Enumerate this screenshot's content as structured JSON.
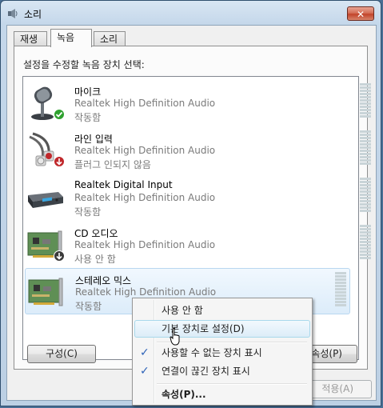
{
  "window": {
    "title": "소리",
    "close_label": "✕"
  },
  "tabs": [
    {
      "label": "재생",
      "active": false
    },
    {
      "label": "녹음",
      "active": true
    },
    {
      "label": "소리",
      "active": false
    }
  ],
  "instruction": "설정을 수정할 녹음 장치 선택:",
  "devices": [
    {
      "name": "마이크",
      "driver": "Realtek High Definition Audio",
      "status": "작동함",
      "icon": "microphone-icon",
      "badge": "check-badge-icon",
      "selected": false
    },
    {
      "name": "라인 입력",
      "driver": "Realtek High Definition Audio",
      "status": "플러그 인되지 않음",
      "icon": "line-in-cable-icon",
      "badge": "unplugged-badge-icon",
      "selected": false
    },
    {
      "name": "Realtek Digital Input",
      "driver": "Realtek High Definition Audio",
      "status": "작동함",
      "icon": "digital-input-box-icon",
      "badge": "",
      "selected": false
    },
    {
      "name": "CD 오디오",
      "driver": "Realtek High Definition Audio",
      "status": "사용 안 함",
      "icon": "sound-card-icon",
      "badge": "disabled-badge-icon",
      "selected": false
    },
    {
      "name": "스테레오 믹스",
      "driver": "Realtek High Definition Audio",
      "status": "작동함",
      "icon": "sound-card-icon",
      "badge": "",
      "selected": true
    }
  ],
  "buttons": {
    "configure": "구성(C)",
    "properties": "속성(P)",
    "apply": "적용(A)"
  },
  "context_menu": {
    "items": [
      {
        "label": "사용 안 함",
        "checked": false,
        "bold": false,
        "hover": false
      },
      {
        "label": "기본 장치로 설정(D)",
        "checked": false,
        "bold": false,
        "hover": true
      },
      {
        "label": "사용할 수 없는 장치 표시",
        "checked": true,
        "bold": false,
        "hover": false
      },
      {
        "label": "연결이 끊긴 장치 표시",
        "checked": true,
        "bold": false,
        "hover": false
      },
      {
        "label": "속성(P)...",
        "checked": false,
        "bold": true,
        "hover": false
      }
    ]
  },
  "colors": {
    "accent": "#2e63b8",
    "selection_border": "#b9d7f0",
    "check_badge": "#2fa12f",
    "unplugged_badge": "#c0282b"
  }
}
